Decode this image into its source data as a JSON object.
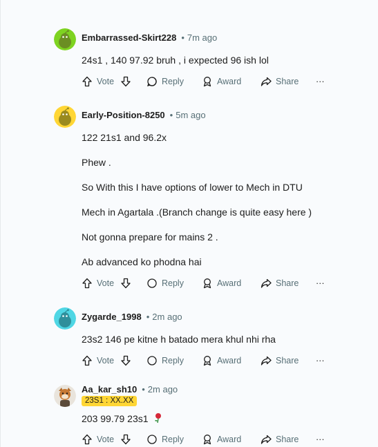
{
  "comments": [
    {
      "username": "Embarrassed-Skirt228",
      "time": "7m ago",
      "avatar_color": "#7ed321",
      "lines": [
        "24s1 , 140 97.92 bruh , i expected 96 ish lol"
      ]
    },
    {
      "username": "Early-Position-8250",
      "time": "5m ago",
      "avatar_color": "#ffd635",
      "lines": [
        "122 21s1 and 96.2x",
        "Phew .",
        "So With this I have options of lower to Mech in DTU",
        "Mech in Agartala .(Branch change is quite easy here )",
        "Not gonna prepare for mains 2 .",
        "Ab advanced ko phodna hai"
      ]
    },
    {
      "username": "Zygarde_1998",
      "time": "2m ago",
      "avatar_color": "#4fd6e4",
      "lines": [
        "23s2 146 pe kitne h batado mera khul nhi rha"
      ]
    },
    {
      "username": "Aa_kar_sh10",
      "time": "2m ago",
      "flair": "23S1 : XX.XX",
      "lines": [
        "203 99.79 23s1"
      ]
    }
  ],
  "actions": {
    "vote": "Vote",
    "reply": "Reply",
    "award": "Award",
    "share": "Share",
    "more": "···"
  }
}
